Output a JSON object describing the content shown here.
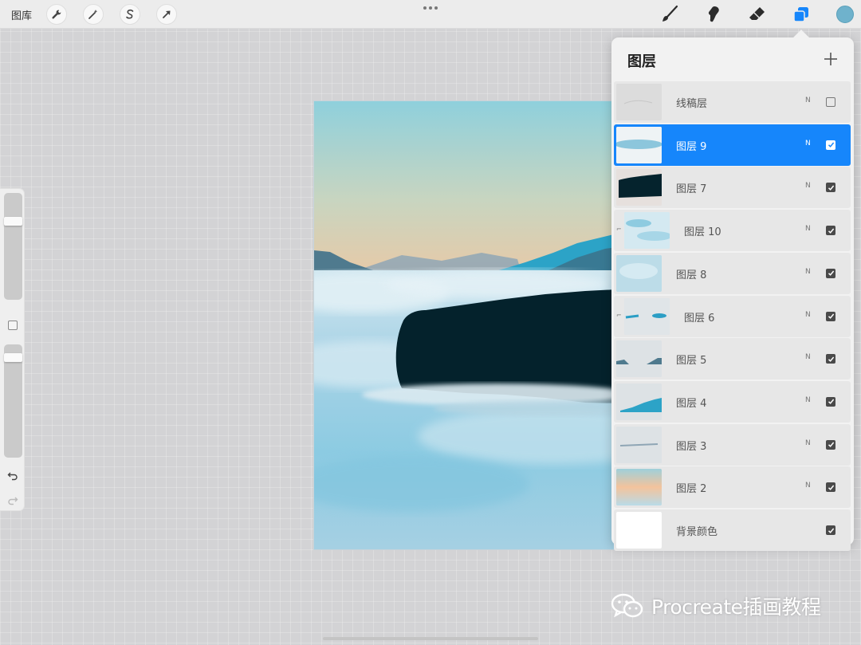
{
  "toolbar": {
    "gallery_label": "图库",
    "left_tools": [
      "wrench-icon",
      "magic-wand-icon",
      "selection-icon",
      "transform-arrow-icon"
    ],
    "right_tools": [
      "brush-icon",
      "smudge-icon",
      "eraser-icon",
      "layers-icon"
    ],
    "current_color": "#6fb2cc"
  },
  "sidebar": {
    "brush_size_level": 0.85,
    "opacity_level": 0.97
  },
  "layers_panel": {
    "title": "图层",
    "add_symbol": "+",
    "layers": [
      {
        "name": "线稿层",
        "mode": "N",
        "visible": false,
        "selected": false,
        "clipped": false,
        "thumb": "sketch"
      },
      {
        "name": "图层 9",
        "mode": "N",
        "visible": true,
        "selected": true,
        "clipped": false,
        "thumb": "mist-band"
      },
      {
        "name": "图层 7",
        "mode": "N",
        "visible": true,
        "selected": false,
        "clipped": false,
        "thumb": "dark-rock"
      },
      {
        "name": "图层 10",
        "mode": "N",
        "visible": true,
        "selected": false,
        "clipped": true,
        "thumb": "light-clouds"
      },
      {
        "name": "图层 8",
        "mode": "N",
        "visible": true,
        "selected": false,
        "clipped": false,
        "thumb": "pale-fog"
      },
      {
        "name": "图层 6",
        "mode": "N",
        "visible": true,
        "selected": false,
        "clipped": true,
        "thumb": "teal-strokes"
      },
      {
        "name": "图层 5",
        "mode": "N",
        "visible": true,
        "selected": false,
        "clipped": false,
        "thumb": "far-hills"
      },
      {
        "name": "图层 4",
        "mode": "N",
        "visible": true,
        "selected": false,
        "clipped": false,
        "thumb": "blue-mountain"
      },
      {
        "name": "图层 3",
        "mode": "N",
        "visible": true,
        "selected": false,
        "clipped": false,
        "thumb": "horizon-line"
      },
      {
        "name": "图层 2",
        "mode": "N",
        "visible": true,
        "selected": false,
        "clipped": false,
        "thumb": "sunset-gradient"
      },
      {
        "name": "背景颜色",
        "mode": "",
        "visible": true,
        "selected": false,
        "clipped": false,
        "thumb": "white"
      }
    ]
  },
  "watermark": {
    "text": "Procreate插画教程"
  },
  "colors": {
    "accent": "#1686fb",
    "sky_top": "#8fd0dc",
    "sky_bottom": "#f4c39a",
    "rock": "#04222c",
    "fog": "#a9d3e6"
  }
}
